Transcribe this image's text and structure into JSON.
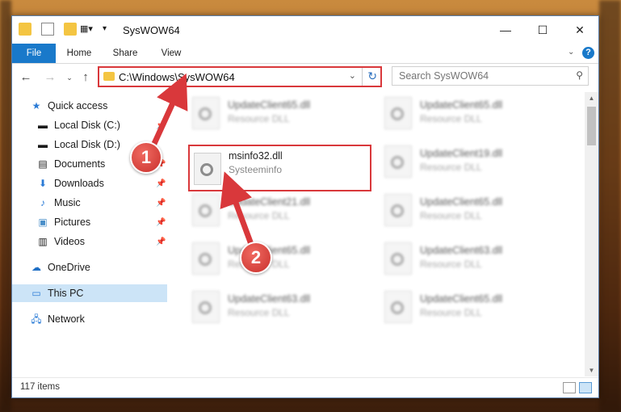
{
  "window": {
    "title": "SysWOW64",
    "minimize_glyph": "—",
    "maximize_glyph": "☐",
    "close_glyph": "✕"
  },
  "ribbon": {
    "tabs": [
      "File",
      "Home",
      "Share",
      "View"
    ],
    "help_glyph": "?"
  },
  "address": {
    "path": "C:\\Windows\\SysWOW64",
    "search_placeholder": "Search SysWOW64"
  },
  "sidebar": {
    "items": [
      {
        "label": "Quick access",
        "icon": "star-icon"
      },
      {
        "label": "Local Disk (C:)",
        "icon": "drive-icon"
      },
      {
        "label": "Local Disk (D:)",
        "icon": "drive-icon"
      },
      {
        "label": "Documents",
        "icon": "documents-icon"
      },
      {
        "label": "Downloads",
        "icon": "download-icon"
      },
      {
        "label": "Music",
        "icon": "music-icon"
      },
      {
        "label": "Pictures",
        "icon": "pictures-icon"
      },
      {
        "label": "Videos",
        "icon": "videos-icon"
      },
      {
        "label": "OneDrive",
        "icon": "cloud-icon"
      },
      {
        "label": "This PC",
        "icon": "computer-icon",
        "selected": true
      },
      {
        "label": "Network",
        "icon": "network-icon"
      }
    ]
  },
  "files": [
    {
      "name": "UpdateClient65.dll",
      "type": "Resource DLL",
      "blurred": true
    },
    {
      "name": "UpdateClient65.dll",
      "type": "Resource DLL",
      "blurred": true
    },
    {
      "name": "msinfo32.dll",
      "type": "Systeeminfo",
      "blurred": false,
      "highlighted": true
    },
    {
      "name": "UpdateClient19.dll",
      "type": "Resource DLL",
      "blurred": true
    },
    {
      "name": "UpdateClient21.dll",
      "type": "Resource DLL",
      "blurred": true
    },
    {
      "name": "UpdateClient65.dll",
      "type": "Resource DLL",
      "blurred": true
    },
    {
      "name": "UpdateClient65.dll",
      "type": "Resource DLL",
      "blurred": true
    },
    {
      "name": "UpdateClient63.dll",
      "type": "Resource DLL",
      "blurred": true
    },
    {
      "name": "UpdateClient63.dll",
      "type": "Resource DLL",
      "blurred": true
    },
    {
      "name": "UpdateClient65.dll",
      "type": "Resource DLL",
      "blurred": true
    }
  ],
  "status": {
    "item_count": "117 items"
  },
  "annotations": [
    {
      "number": "1",
      "color": "#d9383b"
    },
    {
      "number": "2",
      "color": "#d9383b"
    }
  ],
  "colors": {
    "accent": "#1979ca",
    "highlight": "#d9383b",
    "selected_nav": "#cce4f7"
  }
}
